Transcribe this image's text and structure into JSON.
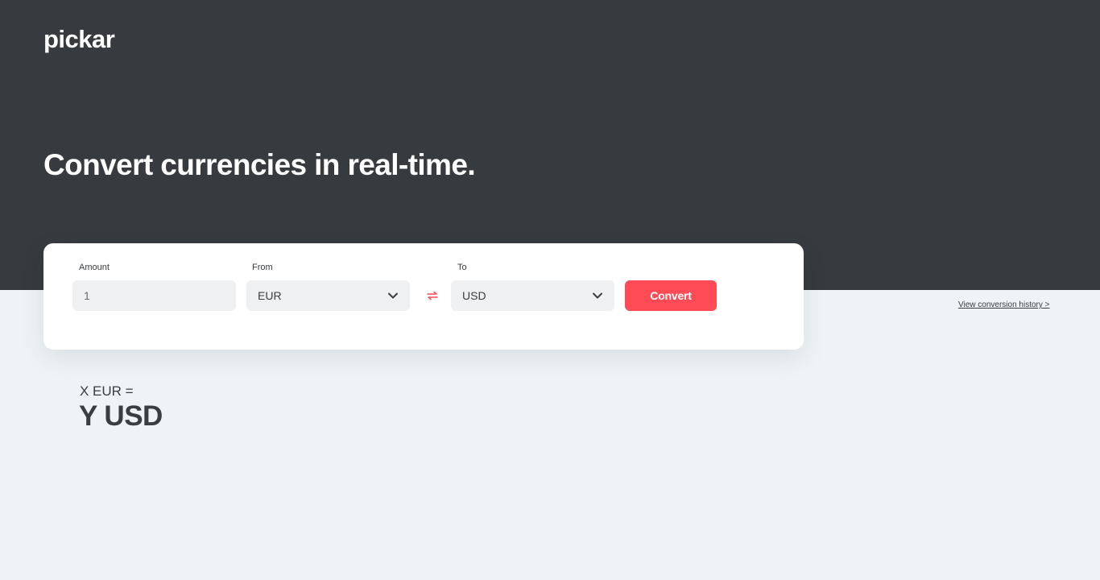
{
  "brand": {
    "logo_text": "pickar"
  },
  "hero": {
    "headline": "Convert currencies in real-time."
  },
  "converter": {
    "amount_label": "Amount",
    "amount_value": "1",
    "from_label": "From",
    "from_value": "EUR",
    "to_label": "To",
    "to_value": "USD",
    "convert_label": "Convert",
    "swap_icon": "swap-arrows-icon",
    "accent_color": "#ff4b55"
  },
  "links": {
    "history": "View conversion history >"
  },
  "result": {
    "from_text": "X EUR =",
    "to_text": "Y USD"
  }
}
